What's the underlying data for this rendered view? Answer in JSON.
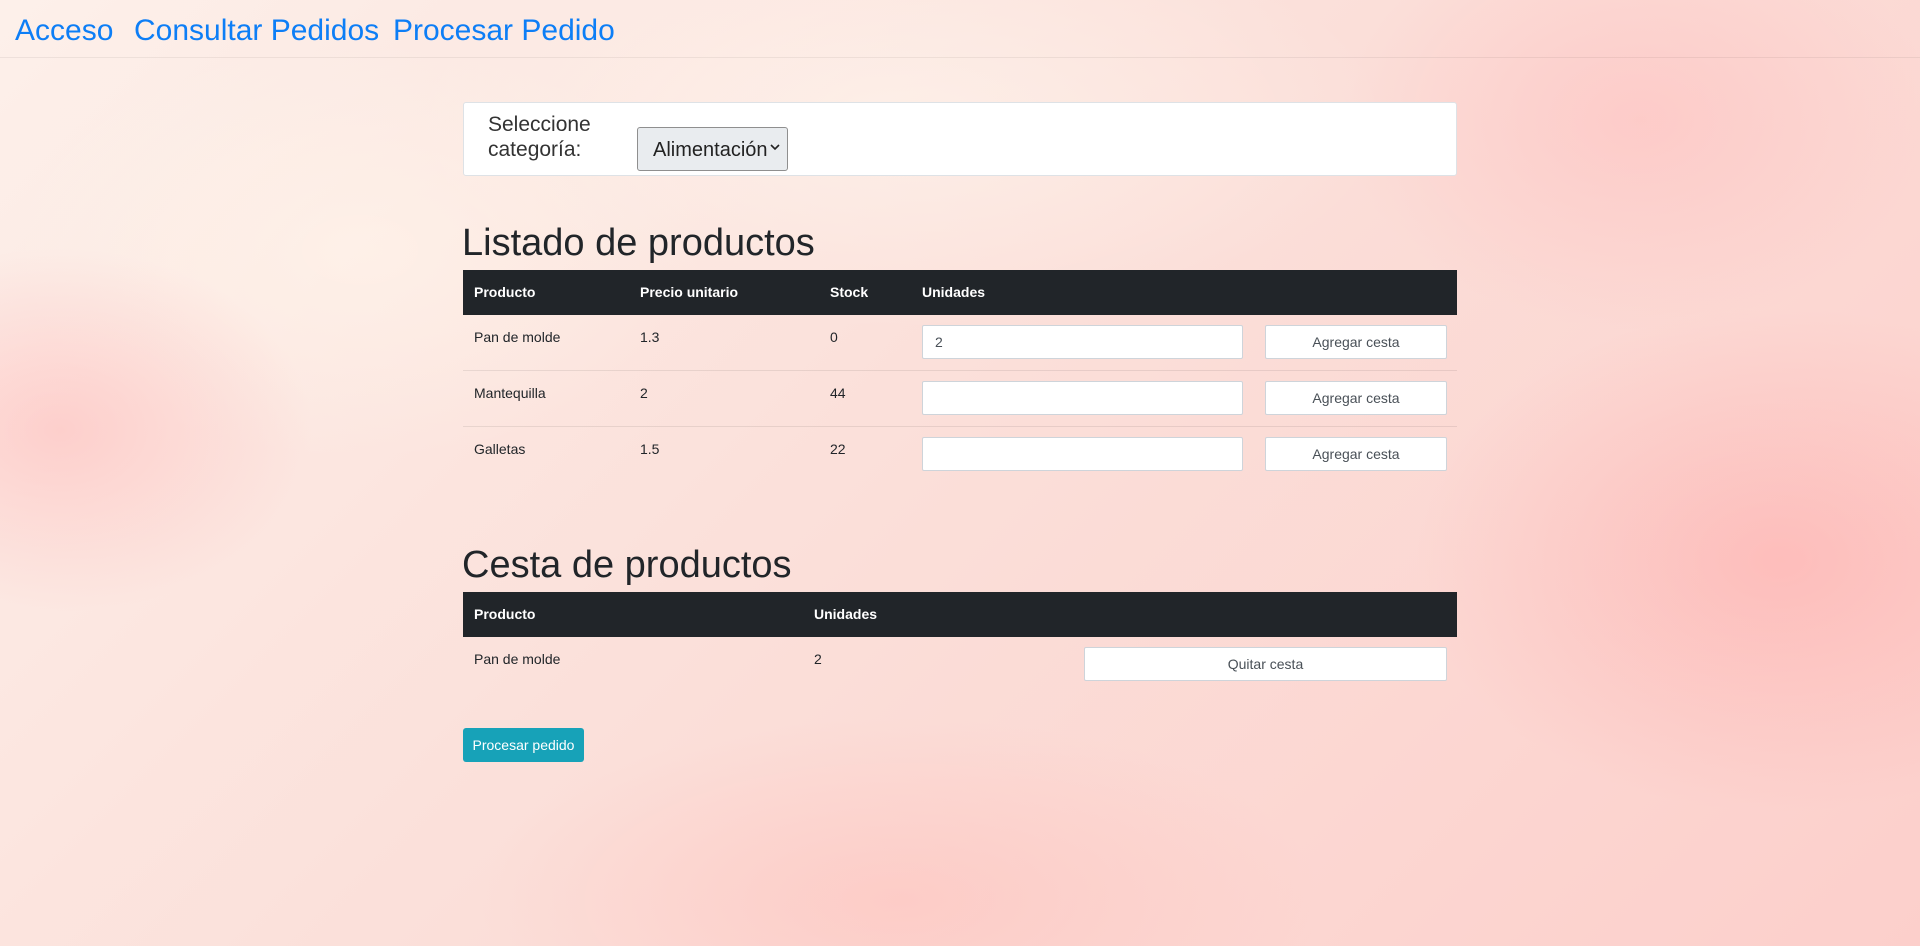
{
  "nav": {
    "acceso": "Acceso",
    "consultar": "Consultar Pedidos",
    "procesar": "Procesar Pedido"
  },
  "category": {
    "label": "Seleccione categoría:",
    "selected": "Alimentación"
  },
  "products": {
    "title": "Listado de productos",
    "headers": {
      "product": "Producto",
      "price": "Precio unitario",
      "stock": "Stock",
      "units": "Unidades"
    },
    "rows": [
      {
        "name": "Pan de molde",
        "price": "1.3",
        "stock": "0",
        "units": "2",
        "action": "Agregar cesta"
      },
      {
        "name": "Mantequilla",
        "price": "2",
        "stock": "44",
        "units": "",
        "action": "Agregar cesta"
      },
      {
        "name": "Galletas",
        "price": "1.5",
        "stock": "22",
        "units": "",
        "action": "Agregar cesta"
      }
    ]
  },
  "basket": {
    "title": "Cesta de productos",
    "headers": {
      "product": "Producto",
      "units": "Unidades"
    },
    "rows": [
      {
        "name": "Pan de molde",
        "units": "2",
        "action": "Quitar cesta"
      }
    ]
  },
  "process_button": "Procesar pedido",
  "colors": {
    "link": "#0d7ef6",
    "table_header": "#212529",
    "process_button": "#17a2b8"
  }
}
